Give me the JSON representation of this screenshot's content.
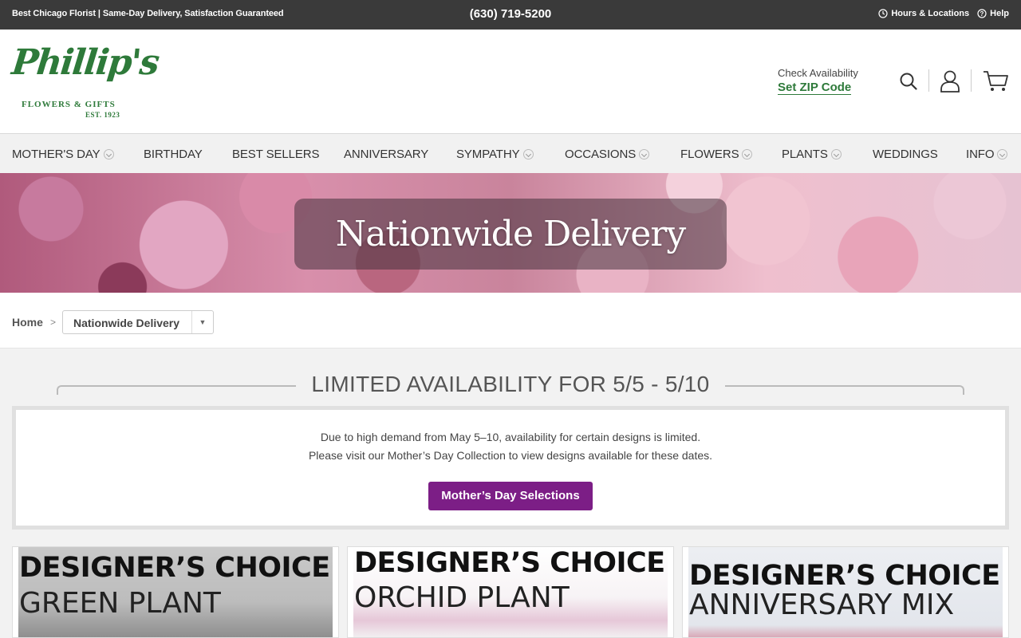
{
  "topbar": {
    "tagline": "Best Chicago Florist | Same-Day Delivery, Satisfaction Guaranteed",
    "phone": "(630) 719-5200",
    "hours": "Hours & Locations",
    "help": "Help"
  },
  "header": {
    "logo_script": "Phillip's",
    "logo_sub": "FLOWERS & GIFTS",
    "logo_est": "EST. 1923",
    "check_availability": "Check Availability",
    "set_zip": "Set ZIP Code",
    "icons": [
      "search-icon",
      "account-icon",
      "cart-icon"
    ]
  },
  "nav": {
    "items": [
      {
        "label": "MOTHER'S DAY",
        "dropdown": true
      },
      {
        "label": "BIRTHDAY",
        "dropdown": false
      },
      {
        "label": "BEST SELLERS",
        "dropdown": false
      },
      {
        "label": "ANNIVERSARY",
        "dropdown": false
      },
      {
        "label": "SYMPATHY",
        "dropdown": true
      },
      {
        "label": "OCCASIONS",
        "dropdown": true
      },
      {
        "label": "FLOWERS",
        "dropdown": true
      },
      {
        "label": "PLANTS",
        "dropdown": true
      },
      {
        "label": "WEDDINGS",
        "dropdown": false
      },
      {
        "label": "INFO",
        "dropdown": true
      }
    ]
  },
  "hero": {
    "title": "Nationwide Delivery"
  },
  "breadcrumb": {
    "home": "Home",
    "separator": ">",
    "current": "Nationwide Delivery",
    "arrow": "▼"
  },
  "notice": {
    "heading": "LIMITED AVAILABILITY FOR 5/5 - 5/10",
    "line1": "Due to high demand from May 5–10, availability for certain designs is limited.",
    "line2": "Please visit our Mother’s Day Collection to view designs available for these dates.",
    "button": "Mother’s Day Selections"
  },
  "products": [
    {
      "line1": "DESIGNER’S CHOICE",
      "line2": "GREEN PLANT"
    },
    {
      "line1": "DESIGNER’S CHOICE",
      "line2": "ORCHID PLANT"
    },
    {
      "line1": "DESIGNER’S CHOICE",
      "line2": "ANNIVERSARY MIX"
    }
  ],
  "colors": {
    "topbar": "#3a3a3a",
    "brand_green": "#2e7a3a",
    "button_purple": "#7c1e86"
  }
}
